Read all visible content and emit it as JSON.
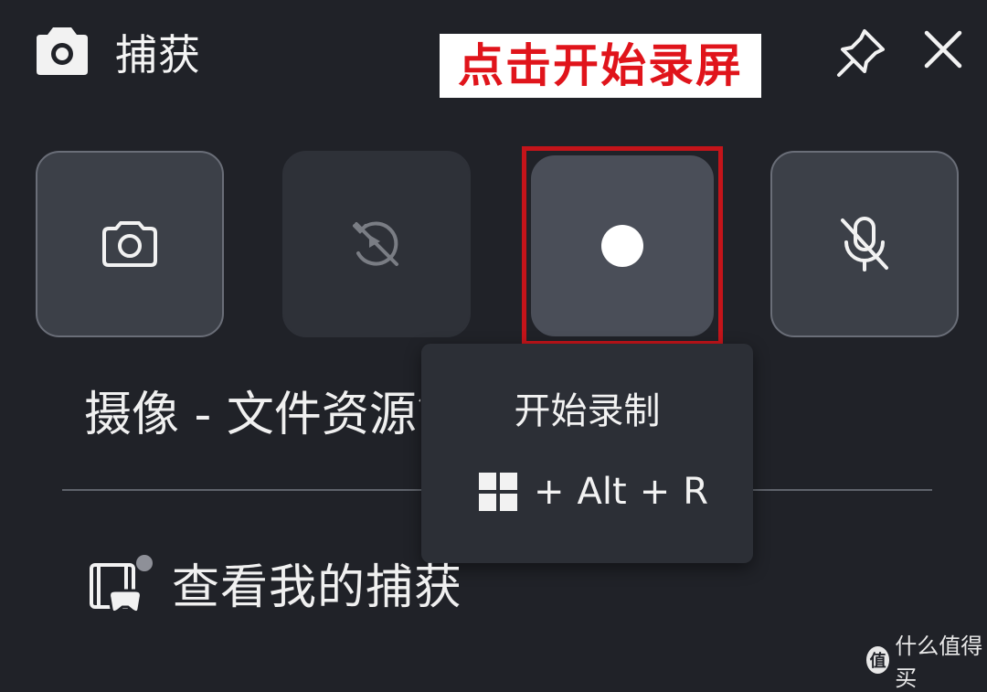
{
  "header": {
    "title": "捕获",
    "annotation": "点击开始录屏"
  },
  "tiles": [
    {
      "name": "screenshot",
      "icon": "camera-icon",
      "state": "enabled"
    },
    {
      "name": "record-last",
      "icon": "record-last-30s-icon",
      "state": "disabled"
    },
    {
      "name": "start-recording",
      "icon": "record-dot-icon",
      "state": "active"
    },
    {
      "name": "mic",
      "icon": "mic-off-icon",
      "state": "enabled"
    }
  ],
  "tooltip": {
    "title": "开始录制",
    "plus1": "+",
    "key_alt": "Alt",
    "plus2": "+",
    "key_r": "R"
  },
  "widget_label": "摄像 - 文件资源管理器",
  "view_captures": "查看我的捕获",
  "watermark": {
    "logo_char": "值",
    "text": "什么值得买"
  },
  "colors": {
    "background": "#202228",
    "highlight": "#c4141a",
    "annotation_text": "#e0141b"
  }
}
